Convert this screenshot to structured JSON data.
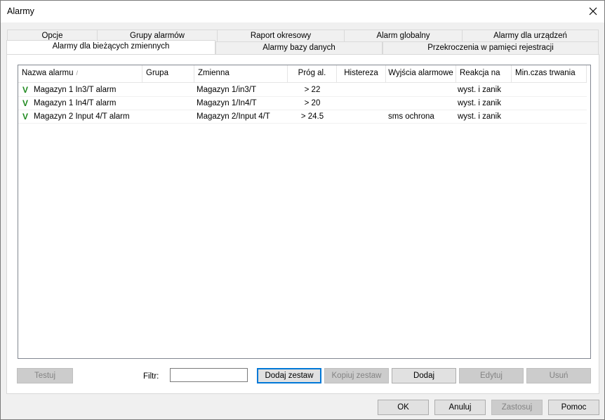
{
  "window": {
    "title": "Alarmy",
    "close_glyph": "close-icon"
  },
  "tabs": {
    "row1": [
      "Opcje",
      "Grupy alarmów",
      "Raport okresowy",
      "Alarm globalny",
      "Alarmy dla urządzeń"
    ],
    "row2": [
      "Alarmy dla bieżących zmiennych",
      "Alarmy bazy danych",
      "Przekroczenia w pamięci rejestracji"
    ],
    "active": "Alarmy dla bieżących zmiennych"
  },
  "table": {
    "columns": [
      "Nazwa alarmu",
      "Grupa",
      "Zmienna",
      "Próg al.",
      "Histereza",
      "Wyjścia alarmowe",
      "Reakcja na",
      "Min.czas trwania"
    ],
    "sort_indicator": "/",
    "rows": [
      {
        "check": "V",
        "name": "Magazyn 1 In3/T alarm",
        "group": "",
        "variable": "Magazyn 1/in3/T",
        "threshold": "> 22",
        "hysteresis": "",
        "outputs": "",
        "reaction": "wyst. i zanik",
        "min_duration": ""
      },
      {
        "check": "V",
        "name": "Magazyn 1 In4/T alarm",
        "group": "",
        "variable": "Magazyn 1/In4/T",
        "threshold": "> 20",
        "hysteresis": "",
        "outputs": "",
        "reaction": "wyst. i zanik",
        "min_duration": ""
      },
      {
        "check": "V",
        "name": "Magazyn 2 Input 4/T alarm",
        "group": "",
        "variable": "Magazyn 2/Input 4/T",
        "threshold": "> 24.5",
        "hysteresis": "",
        "outputs": "sms ochrona",
        "reaction": "wyst. i zanik",
        "min_duration": ""
      }
    ]
  },
  "actions": {
    "test": "Testuj",
    "filter_label": "Filtr:",
    "filter_value": "",
    "add_set": "Dodaj zestaw",
    "copy_set": "Kopiuj zestaw",
    "add": "Dodaj",
    "edit": "Edytuj",
    "delete": "Usuń"
  },
  "footer": {
    "ok": "OK",
    "cancel": "Anuluj",
    "apply": "Zastosuj",
    "help": "Pomoc"
  }
}
